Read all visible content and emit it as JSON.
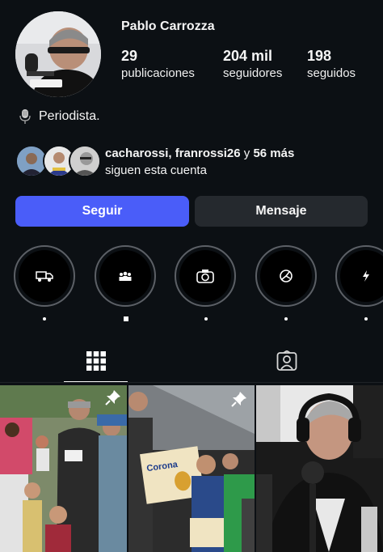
{
  "profile": {
    "name": "Pablo Carrozza",
    "stats": [
      {
        "value": "29",
        "label": "publicaciones"
      },
      {
        "value": "204 mil",
        "label": "seguidores"
      },
      {
        "value": "198",
        "label": "seguidos"
      }
    ],
    "bio": "Periodista.",
    "bio_icon": "microphone-icon"
  },
  "followed_by": {
    "names": "cacharossi, franrossi26",
    "connector": "y",
    "more": "56 más",
    "suffix": "siguen esta cuenta"
  },
  "buttons": {
    "follow": "Seguir",
    "message": "Mensaje"
  },
  "highlights": [
    {
      "icon": "truck-icon"
    },
    {
      "icon": "group-icon"
    },
    {
      "icon": "camera-icon"
    },
    {
      "icon": "ball-icon"
    },
    {
      "icon": "lightning-icon"
    }
  ],
  "tabs": [
    {
      "icon": "grid-icon",
      "active": true
    },
    {
      "icon": "tagged-icon",
      "active": false
    }
  ],
  "colors": {
    "background": "#0c1014",
    "follow_button": "#4a5df9",
    "message_button": "#25292e"
  }
}
